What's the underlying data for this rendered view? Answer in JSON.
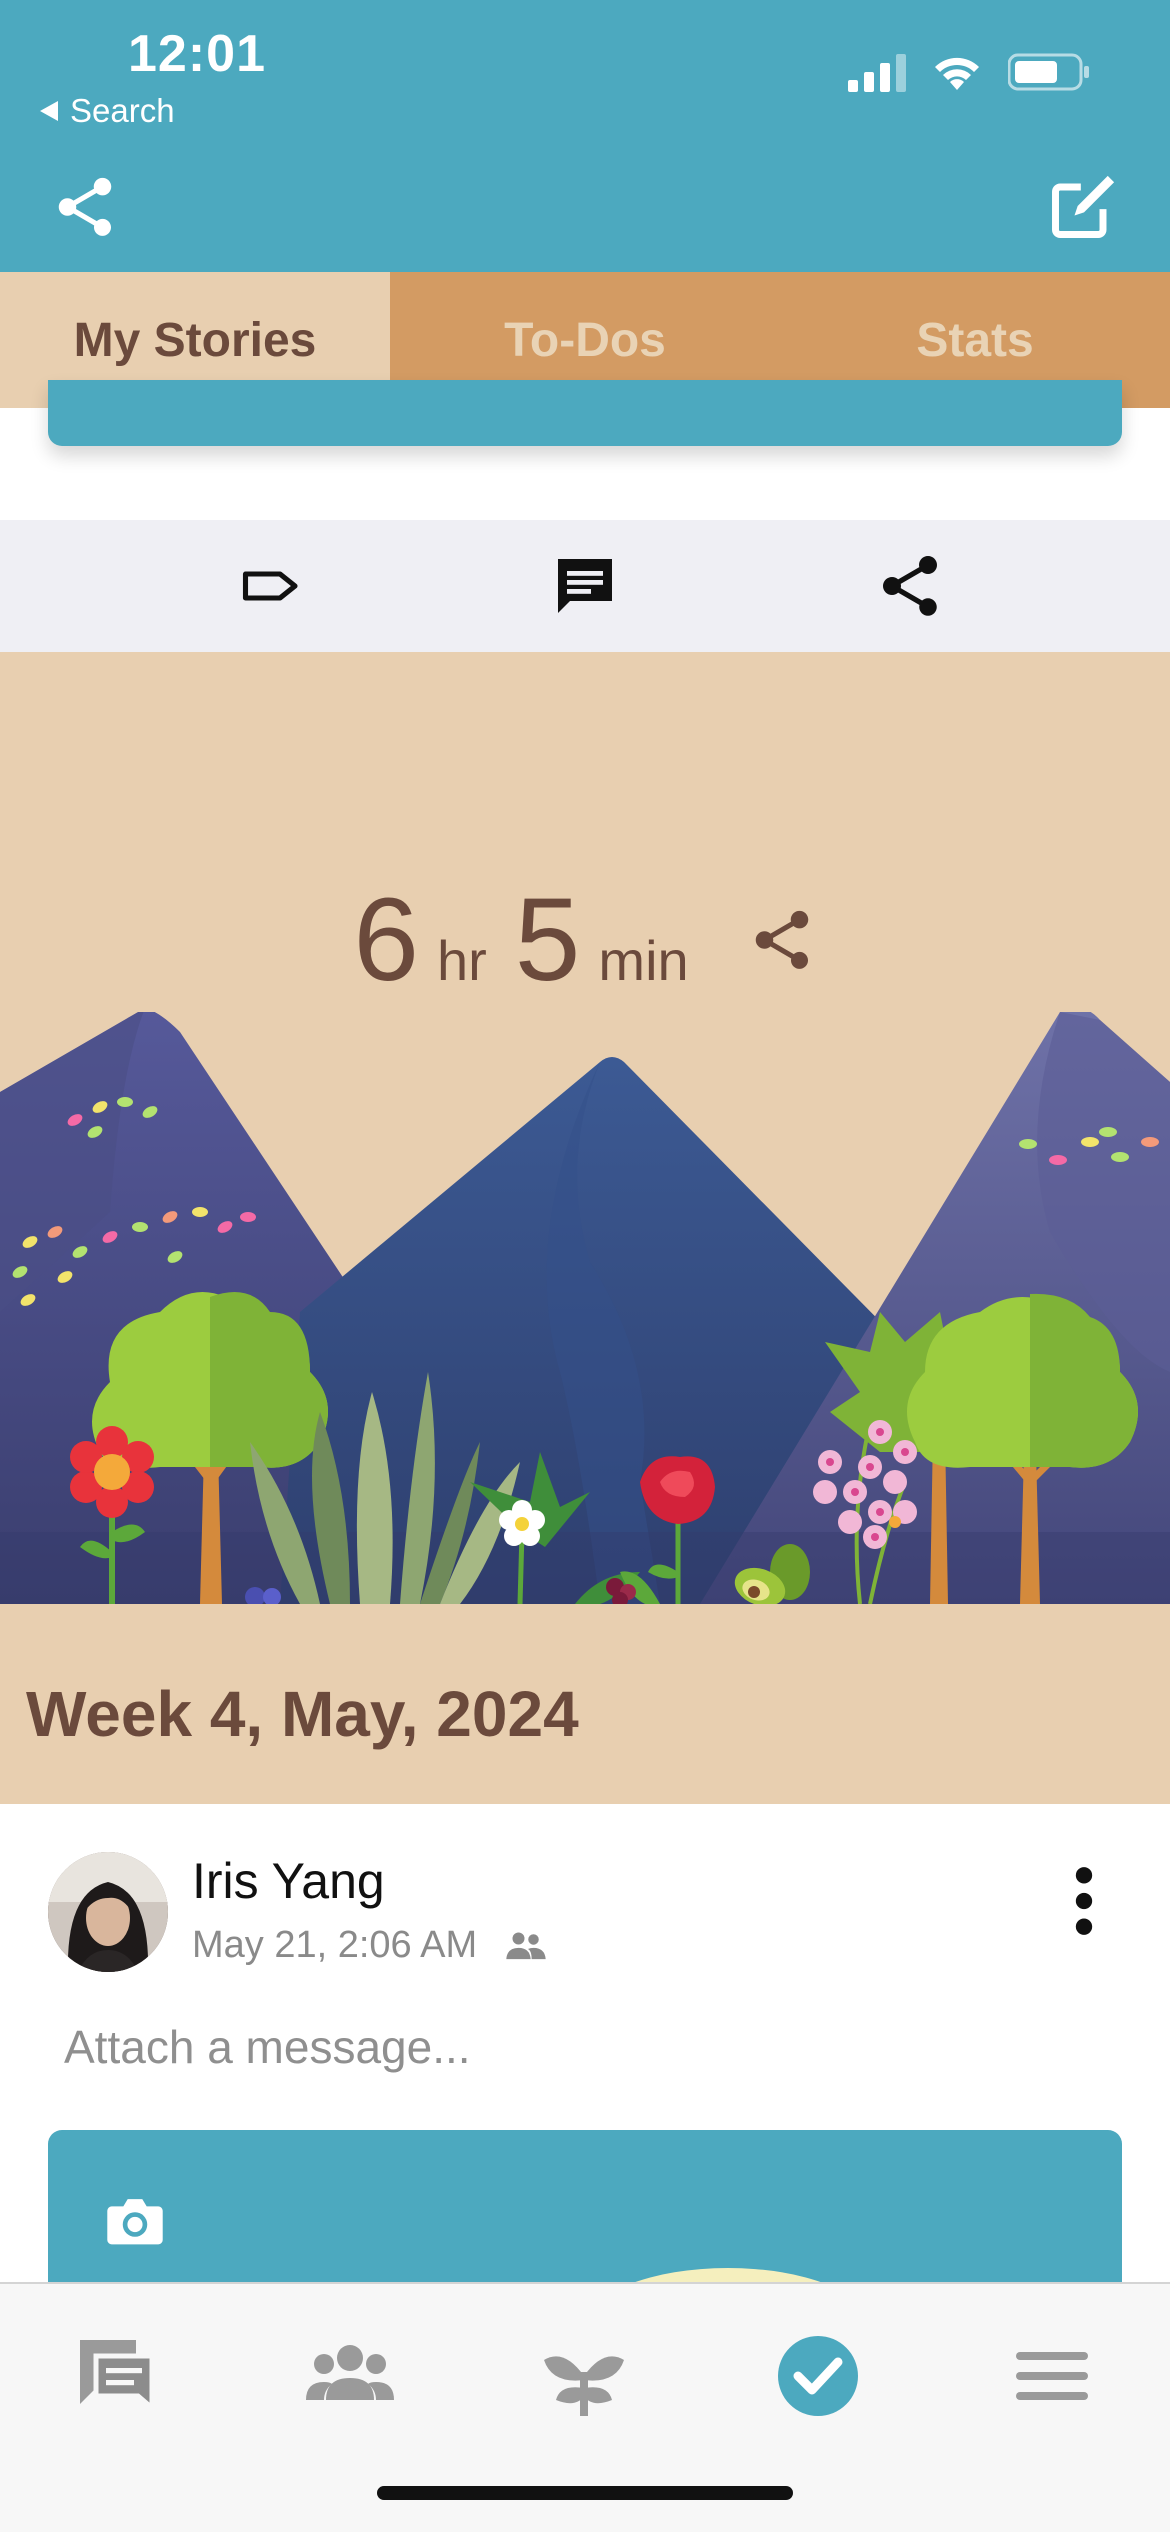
{
  "status_bar": {
    "time": "12:01",
    "back_label": "Search"
  },
  "header": {
    "share_icon": "share-icon",
    "edit_icon": "edit-icon"
  },
  "tabs": [
    {
      "label": "My Stories",
      "active": true
    },
    {
      "label": "To-Dos",
      "active": false
    },
    {
      "label": "Stats",
      "active": false
    }
  ],
  "action_bar": {
    "icons": [
      "tag-icon",
      "comment-icon",
      "share-icon"
    ]
  },
  "story": {
    "duration": {
      "hours": "6",
      "hours_unit": "hr",
      "minutes": "5",
      "minutes_unit": "min"
    },
    "week_label": "Week 4, May, 2024"
  },
  "post": {
    "author": "Iris Yang",
    "date": "May 21, 2:06 AM",
    "message_placeholder": "Attach a message..."
  },
  "bottom_nav": {
    "items": [
      "chat-icon",
      "friends-icon",
      "plant-icon",
      "todo-check-icon",
      "menu-icon"
    ],
    "active": "todo-check-icon"
  },
  "colors": {
    "teal": "#4ca9bf",
    "tab_orange": "#d39b63",
    "sand": "#e8cfb0",
    "brown_text": "#6b4a3c",
    "action_bar_bg": "#efeff4"
  }
}
